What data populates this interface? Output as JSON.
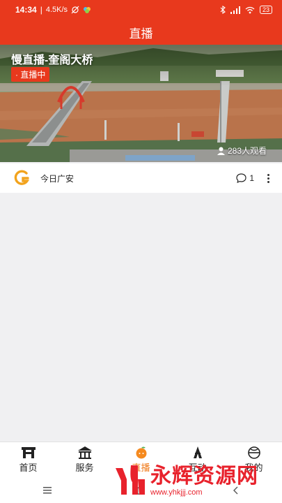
{
  "status_bar": {
    "time": "14:34",
    "speed": "4.5K/s",
    "battery": "23"
  },
  "header": {
    "title": "直播"
  },
  "hero": {
    "title": "慢直播-奎阁大桥",
    "badge": "· 直播中",
    "viewers": "283人观看"
  },
  "source": {
    "name": "今日广安",
    "comment_count": "1"
  },
  "tab_bar": {
    "tabs": [
      {
        "label": "首页",
        "icon": "home-gate-icon"
      },
      {
        "label": "服务",
        "icon": "pavilion-icon"
      },
      {
        "label": "直播",
        "icon": "orange-mascot-icon",
        "active": true
      },
      {
        "label": "互动",
        "icon": "tower-icon"
      },
      {
        "label": "我的",
        "icon": "profile-globe-icon"
      }
    ],
    "active_color": "#f07a1a"
  },
  "watermark": {
    "text": "永辉资源网",
    "url": "www.yhkjjj.com"
  },
  "colors": {
    "brand_red": "#e8391d",
    "background": "#f0f0f2"
  }
}
